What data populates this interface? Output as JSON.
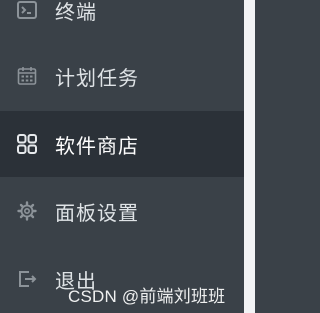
{
  "menu": {
    "items": [
      {
        "label": "终端",
        "icon": "terminal-icon",
        "active": false
      },
      {
        "label": "计划任务",
        "icon": "calendar-icon",
        "active": false
      },
      {
        "label": "软件商店",
        "icon": "grid-apps-icon",
        "active": true
      },
      {
        "label": "面板设置",
        "icon": "gear-icon",
        "active": false
      },
      {
        "label": "退出",
        "icon": "logout-icon",
        "active": false
      }
    ]
  },
  "watermark": {
    "text": "CSDN @前端刘班班"
  },
  "colors": {
    "sidebar_bg": "#3a4148",
    "active_bg": "#2b3138",
    "text": "#dfe3e6",
    "icon": "#8c9399",
    "active_icon": "#e6e9ec"
  }
}
